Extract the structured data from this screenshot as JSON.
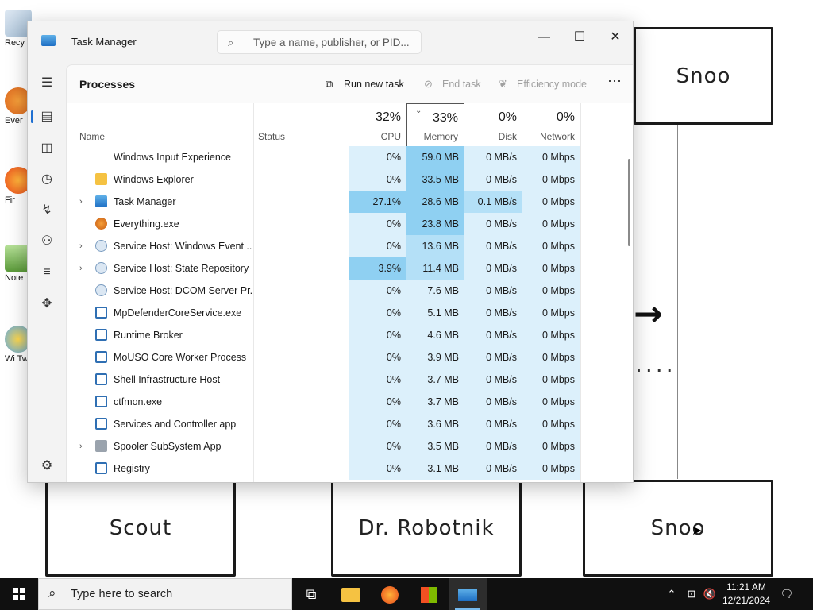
{
  "desktop": {
    "boxes": [
      "Snoo",
      "Scout",
      "Dr. Robotnik",
      "Snoo"
    ],
    "icon_labels": [
      "Recy",
      "Ever",
      "Fir",
      "Note",
      "Wi Tw"
    ]
  },
  "window": {
    "title": "Task Manager",
    "search_placeholder": "Type a name, publisher, or PID...",
    "controls": {
      "minimize": "—",
      "maximize": "☐",
      "close": "✕"
    }
  },
  "toolbar": {
    "page_title": "Processes",
    "run_new_task": "Run new task",
    "end_task": "End task",
    "efficiency_mode": "Efficiency mode",
    "more": "⋯"
  },
  "columns": {
    "name": "Name",
    "status": "Status",
    "cpu_pct": "32%",
    "cpu": "CPU",
    "memory_pct": "33%",
    "memory": "Memory",
    "disk_pct": "0%",
    "disk": "Disk",
    "network_pct": "0%",
    "network": "Network"
  },
  "processes": [
    {
      "name": "Windows Input Experience",
      "cpu": "0%",
      "memory": "59.0 MB",
      "disk": "0 MB/s",
      "network": "0 Mbps",
      "expandable": false,
      "icon": "none"
    },
    {
      "name": "Windows Explorer",
      "cpu": "0%",
      "memory": "33.5 MB",
      "disk": "0 MB/s",
      "network": "0 Mbps",
      "expandable": false,
      "icon": "folder"
    },
    {
      "name": "Task Manager",
      "cpu": "27.1%",
      "memory": "28.6 MB",
      "disk": "0.1 MB/s",
      "network": "0 Mbps",
      "expandable": true,
      "icon": "taskmgr"
    },
    {
      "name": "Everything.exe",
      "cpu": "0%",
      "memory": "23.8 MB",
      "disk": "0 MB/s",
      "network": "0 Mbps",
      "expandable": false,
      "icon": "search"
    },
    {
      "name": "Service Host: Windows Event ...",
      "cpu": "0%",
      "memory": "13.6 MB",
      "disk": "0 MB/s",
      "network": "0 Mbps",
      "expandable": true,
      "icon": "gear"
    },
    {
      "name": "Service Host: State Repository ...",
      "cpu": "3.9%",
      "memory": "11.4 MB",
      "disk": "0 MB/s",
      "network": "0 Mbps",
      "expandable": true,
      "icon": "gear"
    },
    {
      "name": "Service Host: DCOM Server Pr...",
      "cpu": "0%",
      "memory": "7.6 MB",
      "disk": "0 MB/s",
      "network": "0 Mbps",
      "expandable": false,
      "icon": "gear"
    },
    {
      "name": "MpDefenderCoreService.exe",
      "cpu": "0%",
      "memory": "5.1 MB",
      "disk": "0 MB/s",
      "network": "0 Mbps",
      "expandable": false,
      "icon": "app"
    },
    {
      "name": "Runtime Broker",
      "cpu": "0%",
      "memory": "4.6 MB",
      "disk": "0 MB/s",
      "network": "0 Mbps",
      "expandable": false,
      "icon": "app"
    },
    {
      "name": "MoUSO Core Worker Process",
      "cpu": "0%",
      "memory": "3.9 MB",
      "disk": "0 MB/s",
      "network": "0 Mbps",
      "expandable": false,
      "icon": "app"
    },
    {
      "name": "Shell Infrastructure Host",
      "cpu": "0%",
      "memory": "3.7 MB",
      "disk": "0 MB/s",
      "network": "0 Mbps",
      "expandable": false,
      "icon": "app"
    },
    {
      "name": "ctfmon.exe",
      "cpu": "0%",
      "memory": "3.7 MB",
      "disk": "0 MB/s",
      "network": "0 Mbps",
      "expandable": false,
      "icon": "app"
    },
    {
      "name": "Services and Controller app",
      "cpu": "0%",
      "memory": "3.6 MB",
      "disk": "0 MB/s",
      "network": "0 Mbps",
      "expandable": false,
      "icon": "app"
    },
    {
      "name": "Spooler SubSystem App",
      "cpu": "0%",
      "memory": "3.5 MB",
      "disk": "0 MB/s",
      "network": "0 Mbps",
      "expandable": true,
      "icon": "printer"
    },
    {
      "name": "Registry",
      "cpu": "0%",
      "memory": "3.1 MB",
      "disk": "0 MB/s",
      "network": "0 Mbps",
      "expandable": false,
      "icon": "app"
    }
  ],
  "colors": {
    "heat_low": "#dcf0fb",
    "heat_mid": "#b4e0f7",
    "heat_high": "#8fd0f2",
    "accent": "#1f6fd1"
  },
  "taskbar": {
    "search_text": "Type here to search",
    "time": "11:21 AM",
    "date": "12/21/2024"
  }
}
